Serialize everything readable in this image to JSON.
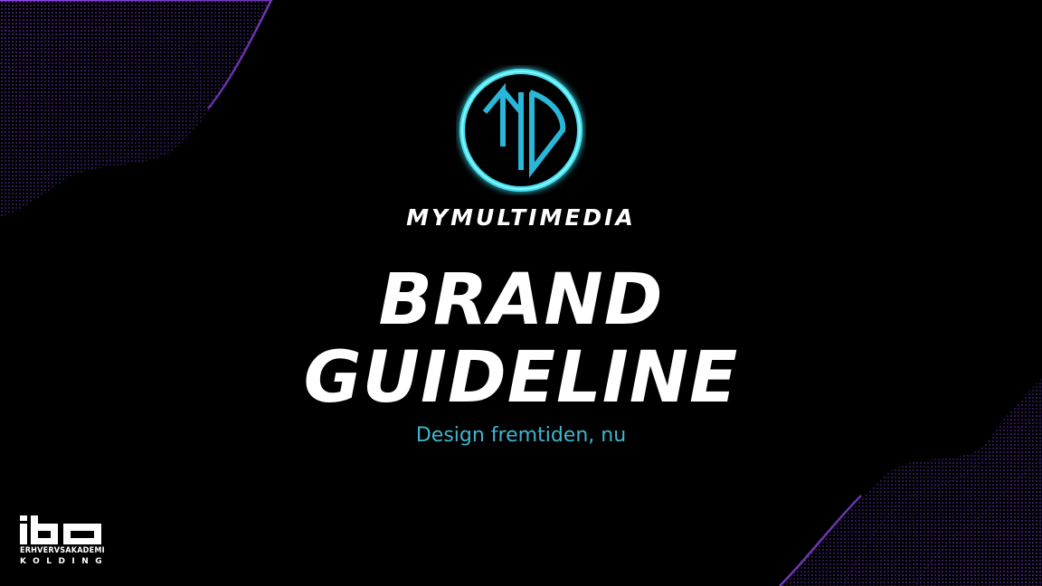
{
  "brand": {
    "name": "MYMULTIMEDIA",
    "logo_icon": "mymultimedia-md-logo",
    "logo_color": "#29b6d8",
    "glow_color": "#3fe0f0"
  },
  "title": {
    "line1": "BRAND",
    "line2": "GUIDELINE"
  },
  "subtitle": "Design fremtiden, nu",
  "institution": {
    "logo_icon": "iba-logo",
    "line1": "ERHVERVSAKADEMI",
    "line2": "KOLDING"
  },
  "colors": {
    "background": "#000000",
    "text": "#ffffff",
    "accent": "#3fb6cf",
    "wave": "#8a3ff0"
  },
  "decorations": {
    "top_left": "purple-particle-wave",
    "bottom_right": "purple-particle-wave"
  }
}
